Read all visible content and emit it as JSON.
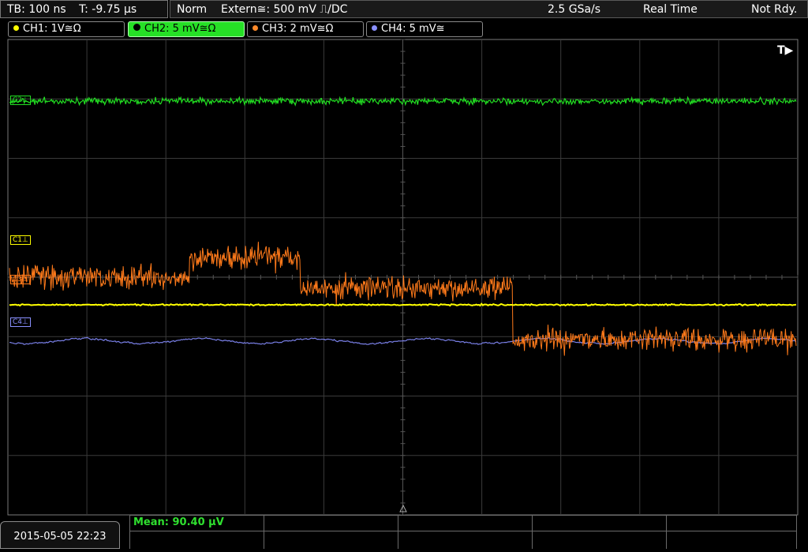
{
  "header": {
    "timebase": "TB: 100 ns",
    "trigger_time": "T: -9.75 µs",
    "acq_mode": "Norm",
    "trigger_source": "Extern≅: 500 mV ⎍/DC",
    "sample_rate": "2.5 GSa/s",
    "mode": "Real Time",
    "status": "Not Rdy."
  },
  "channels": [
    {
      "name": "CH1: 1V≅Ω",
      "color": "#ffff00"
    },
    {
      "name": "CH2: 5 mV≅Ω",
      "color": "#26e026"
    },
    {
      "name": "CH3: 2 mV≅Ω",
      "color": "#ff8a2a"
    },
    {
      "name": "CH4: 5 mV≅",
      "color": "#8a90ff"
    }
  ],
  "trace_labels": {
    "c1": "C1⊥",
    "c2": "C2⊥",
    "c3": "C3⊥",
    "c4": "C4⊥"
  },
  "trigger_marker": "T▶",
  "footer": {
    "datetime": "2015-05-05 22:23",
    "mean": "Mean: 90.40 µV"
  },
  "colors": {
    "grid": "#3a3a3a",
    "background": "#000000",
    "ch1": "#ffff00",
    "ch2": "#22dd22",
    "ch3": "#ff7a1a",
    "ch4": "#7a80e8"
  }
}
